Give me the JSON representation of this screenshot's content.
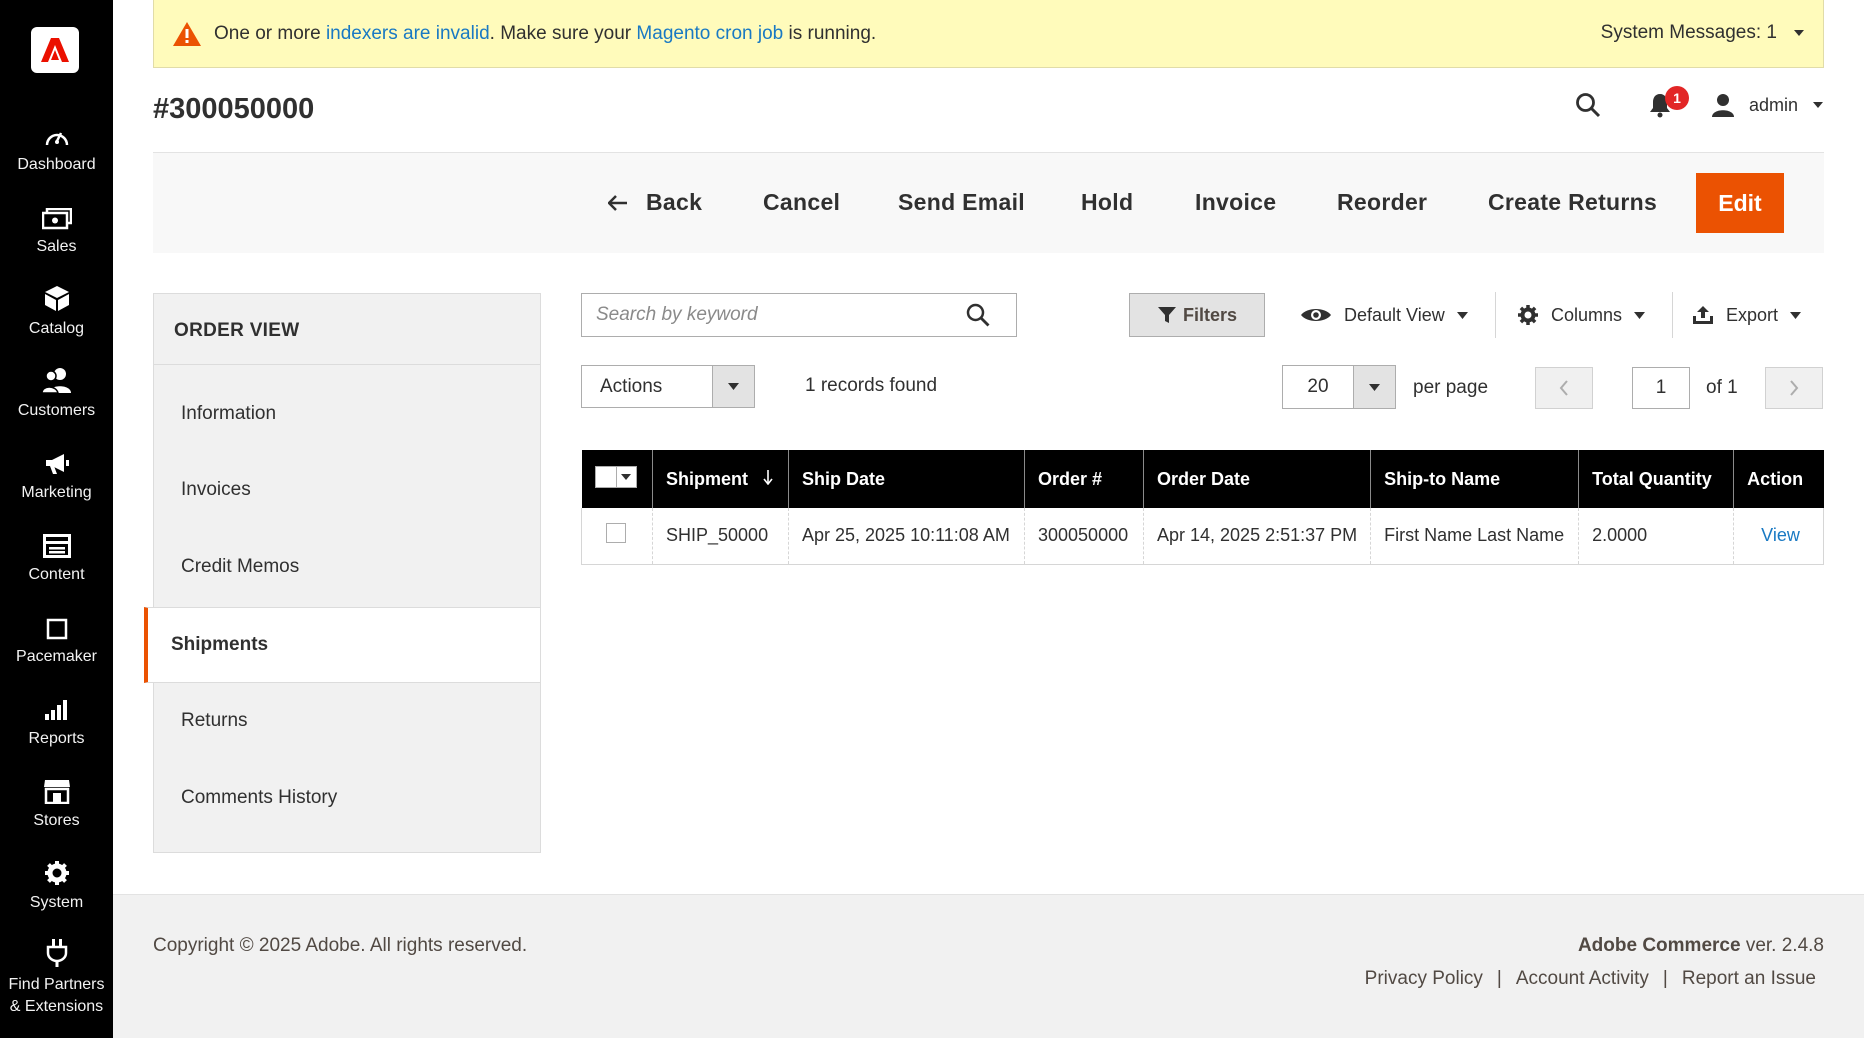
{
  "sidebar": {
    "items": [
      {
        "label": "Dashboard",
        "icon": "dashboard-icon"
      },
      {
        "label": "Sales",
        "icon": "sales-icon"
      },
      {
        "label": "Catalog",
        "icon": "catalog-icon"
      },
      {
        "label": "Customers",
        "icon": "customers-icon"
      },
      {
        "label": "Marketing",
        "icon": "marketing-icon"
      },
      {
        "label": "Content",
        "icon": "content-icon"
      },
      {
        "label": "Pacemaker",
        "icon": "pacemaker-icon"
      },
      {
        "label": "Reports",
        "icon": "reports-icon"
      },
      {
        "label": "Stores",
        "icon": "stores-icon"
      },
      {
        "label": "System",
        "icon": "system-icon"
      },
      {
        "label": "Find Partners & Extensions",
        "icon": "extensions-icon"
      }
    ]
  },
  "notice": {
    "prefix": "One or more ",
    "link1": "indexers are invalid",
    "middle": ". Make sure your ",
    "link2": "Magento cron job",
    "suffix": " is running.",
    "system_messages": "System Messages: 1"
  },
  "header": {
    "title": "#300050000",
    "notification_count": "1",
    "user": "admin"
  },
  "action_bar": {
    "back": "Back",
    "cancel": "Cancel",
    "send_email": "Send Email",
    "hold": "Hold",
    "invoice": "Invoice",
    "reorder": "Reorder",
    "create_returns": "Create Returns",
    "edit": "Edit"
  },
  "order_view": {
    "title": "ORDER VIEW",
    "tabs": [
      "Information",
      "Invoices",
      "Credit Memos",
      "Shipments",
      "Returns",
      "Comments History"
    ],
    "active_tab": "Shipments"
  },
  "grid": {
    "search_placeholder": "Search by keyword",
    "filters": "Filters",
    "view": "Default View",
    "columns": "Columns",
    "export": "Export",
    "actions": "Actions",
    "records": "1 records found",
    "per_page_value": "20",
    "per_page_label": "per page",
    "page": "1",
    "of_pages": "of 1",
    "headers": [
      "Shipment",
      "Ship Date",
      "Order #",
      "Order Date",
      "Ship-to Name",
      "Total Quantity",
      "Action"
    ],
    "rows": [
      {
        "shipment": "SHIP_50000",
        "ship_date": "Apr 25, 2025 10:11:08 AM",
        "order": "300050000",
        "order_date": "Apr 14, 2025 2:51:37 PM",
        "ship_to": "First Name Last Name",
        "qty": "2.0000",
        "action": "View"
      }
    ]
  },
  "footer": {
    "copyright": "Copyright © 2025 Adobe. All rights reserved.",
    "product": "Adobe Commerce",
    "version": " ver. 2.4.8",
    "links": [
      "Privacy Policy",
      "Account Activity",
      "Report an Issue"
    ]
  },
  "colors": {
    "accent": "#eb5202",
    "link": "#1979c3",
    "notice_bg": "#fffbbb",
    "sidebar_bg": "#000000",
    "badge": "#e22626"
  }
}
